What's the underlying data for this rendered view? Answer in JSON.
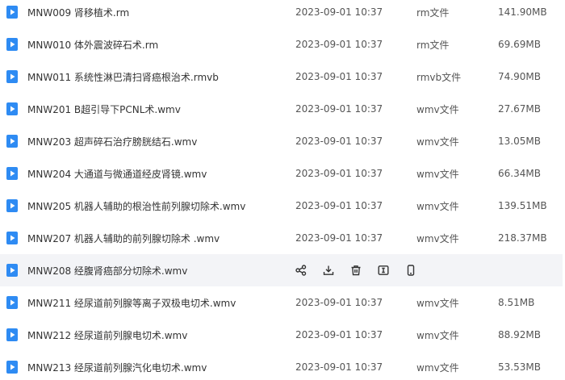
{
  "colors": {
    "icon_blue": "#2e8bf3",
    "hover_bg": "#f3f4f7",
    "action_icon": "#333333"
  },
  "files": [
    {
      "name": "MNW009 肾移植术.rm",
      "date": "2023-09-01 10:37",
      "type": "rm文件",
      "size": "141.90MB"
    },
    {
      "name": "MNW010 体外震波碎石术.rm",
      "date": "2023-09-01 10:37",
      "type": "rm文件",
      "size": "69.69MB"
    },
    {
      "name": "MNW011 系统性淋巴清扫肾癌根治术.rmvb",
      "date": "2023-09-01 10:37",
      "type": "rmvb文件",
      "size": "74.90MB"
    },
    {
      "name": "MNW201 B超引导下PCNL术.wmv",
      "date": "2023-09-01 10:37",
      "type": "wmv文件",
      "size": "27.67MB"
    },
    {
      "name": "MNW203 超声碎石治疗膀胱结石.wmv",
      "date": "2023-09-01 10:37",
      "type": "wmv文件",
      "size": "13.05MB"
    },
    {
      "name": "MNW204 大通道与微通道经皮肾镜.wmv",
      "date": "2023-09-01 10:37",
      "type": "wmv文件",
      "size": "66.34MB"
    },
    {
      "name": "MNW205 机器人辅助的根治性前列腺切除术.wmv",
      "date": "2023-09-01 10:37",
      "type": "wmv文件",
      "size": "139.51MB"
    },
    {
      "name": "MNW207 机器人辅助的前列腺切除术 .wmv",
      "date": "2023-09-01 10:37",
      "type": "wmv文件",
      "size": "218.37MB"
    },
    {
      "name": "MNW208 经腹肾癌部分切除术.wmv",
      "date": "",
      "type": "",
      "size": "",
      "hovered": true
    },
    {
      "name": "MNW211 经尿道前列腺等离子双极电切术.wmv",
      "date": "2023-09-01 10:37",
      "type": "wmv文件",
      "size": "8.51MB"
    },
    {
      "name": "MNW212 经尿道前列腺电切术.wmv",
      "date": "2023-09-01 10:37",
      "type": "wmv文件",
      "size": "88.92MB"
    },
    {
      "name": "MNW213 经尿道前列腺汽化电切术.wmv",
      "date": "2023-09-01 10:37",
      "type": "wmv文件",
      "size": "53.53MB"
    }
  ],
  "row_actions": [
    "share-icon",
    "download-icon",
    "delete-icon",
    "rename-icon",
    "phone-icon"
  ]
}
